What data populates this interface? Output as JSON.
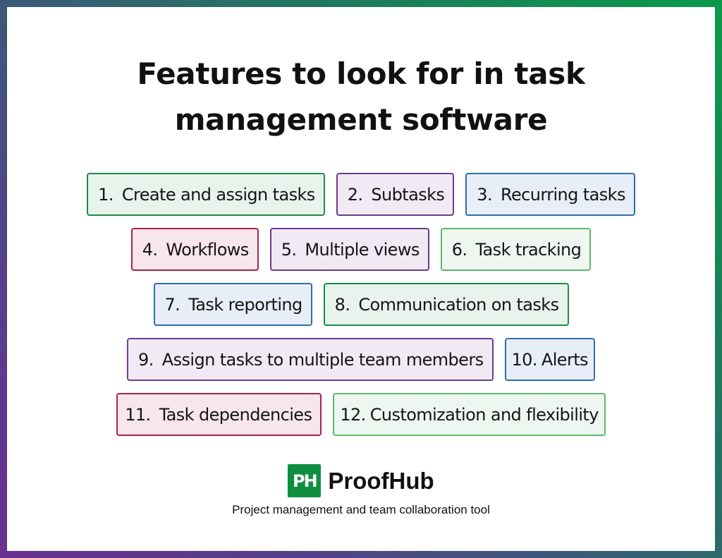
{
  "title": {
    "line1": "Features to look for in task",
    "line2": "management software"
  },
  "colors": {
    "frame_gradient": [
      "#0a9a4a",
      "#2e6b6a",
      "#6a2f90"
    ],
    "green": "#1e8a4a",
    "light_green": "#5cb86a",
    "purple": "#6d3b8e",
    "blue": "#2b6fb0",
    "red": "#a8234f",
    "brand_green": "#0e8f3f"
  },
  "features": [
    {
      "num": "1.",
      "label": "Create and assign tasks",
      "color": "green"
    },
    {
      "num": "2.",
      "label": "Subtasks",
      "color": "purple"
    },
    {
      "num": "3.",
      "label": "Recurring tasks",
      "color": "blue"
    },
    {
      "num": "4.",
      "label": "Workflows",
      "color": "red"
    },
    {
      "num": "5.",
      "label": "Multiple views",
      "color": "purple"
    },
    {
      "num": "6.",
      "label": "Task tracking",
      "color": "light_green"
    },
    {
      "num": "7.",
      "label": "Task reporting",
      "color": "blue"
    },
    {
      "num": "8.",
      "label": "Communication on tasks",
      "color": "green"
    },
    {
      "num": "9.",
      "label": "Assign tasks to multiple team members",
      "color": "purple"
    },
    {
      "num": "10.",
      "label": "Alerts",
      "color": "blue"
    },
    {
      "num": "11.",
      "label": "Task dependencies",
      "color": "red"
    },
    {
      "num": "12.",
      "label": "Customization and flexibility",
      "color": "light_green"
    }
  ],
  "brand": {
    "logo_text": "PH",
    "name": "ProofHub",
    "tagline": "Project management and team collaboration tool"
  }
}
